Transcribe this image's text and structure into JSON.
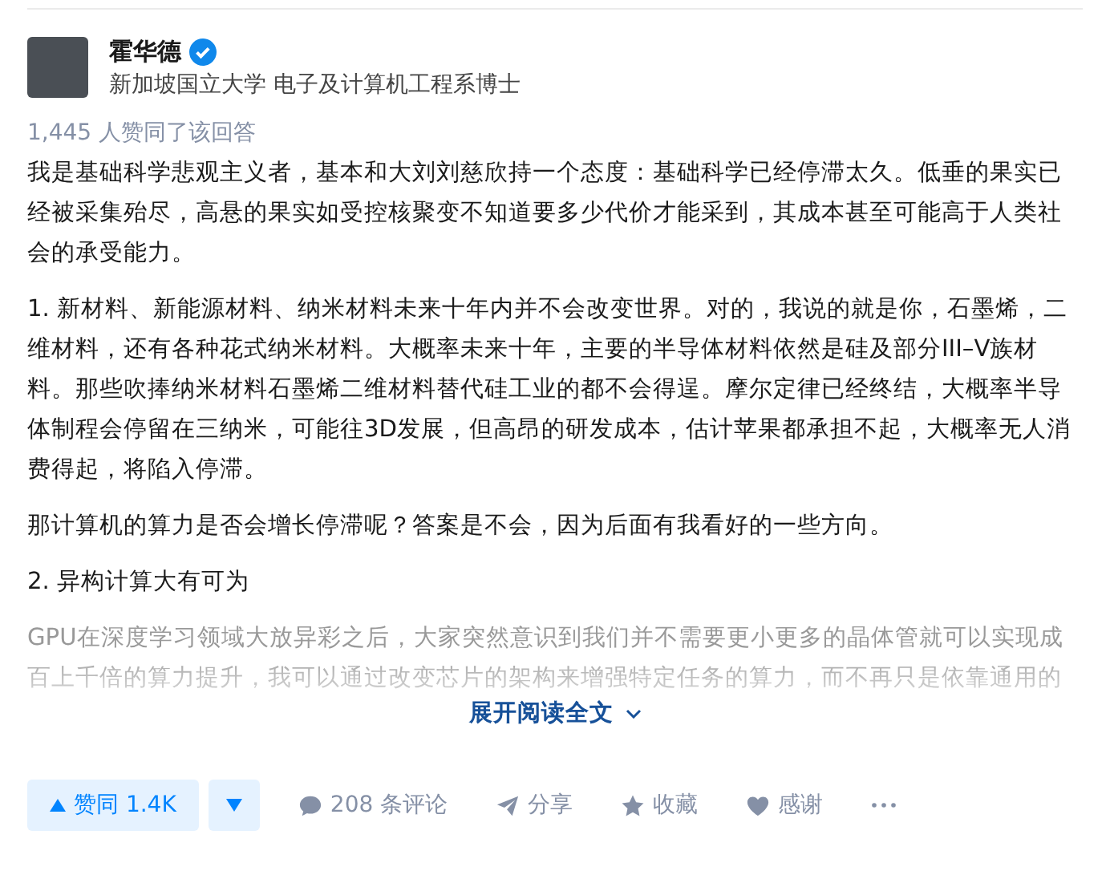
{
  "author": {
    "name": "霍华德",
    "verified": true,
    "headline": "新加坡国立大学 电子及计算机工程系博士"
  },
  "vote_summary": "1,445 人赞同了该回答",
  "paragraphs": [
    "我是基础科学悲观主义者，基本和大刘刘慈欣持一个态度：基础科学已经停滞太久。低垂的果实已经被采集殆尽，高悬的果实如受控核聚变不知道要多少代价才能采到，其成本甚至可能高于人类社会的承受能力。",
    "1. 新材料、新能源材料、纳米材料未来十年内并不会改变世界。对的，我说的就是你，石墨烯，二维材料，还有各种花式纳米材料。大概率未来十年，主要的半导体材料依然是硅及部分III–V族材料。那些吹捧纳米材料石墨烯二维材料替代硅工业的都不会得逞。摩尔定律已经终结，大概率半导体制程会停留在三纳米，可能往3D发展，但高昂的研发成本，估计苹果都承担不起，大概率无人消费得起，将陷入停滞。",
    "那计算机的算力是否会增长停滞呢？答案是不会，因为后面有我看好的一些方向。",
    "2. 异构计算大有可为"
  ],
  "faded_paragraph": "GPU在深度学习领域大放异彩之后，大家突然意识到我们并不需要更小更多的晶体管就可以实现成百上千倍的算力提升，我可以通过改变芯片的架构来增强特定任务的算力，而不再只是依靠通用的",
  "expand_button": "展开阅读全文",
  "actions": {
    "upvote": "赞同 1.4K",
    "comments": "208 条评论",
    "share": "分享",
    "favorite": "收藏",
    "thanks": "感谢"
  }
}
